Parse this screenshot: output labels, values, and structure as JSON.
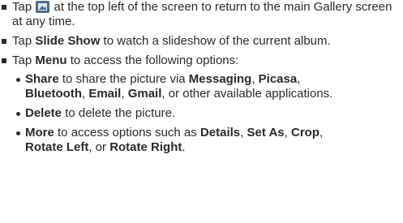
{
  "items": [
    {
      "before": "Tap ",
      "icon": "gallery-back-icon",
      "after": " at the top left of the screen to return to the main Gallery screen at any time."
    },
    {
      "pre": "Tap ",
      "bold": "Slide Show",
      "post": " to watch a slideshow of the current album."
    },
    {
      "pre": "Tap ",
      "bold": "Menu",
      "post": " to access the following options:"
    }
  ],
  "sub": {
    "share": {
      "bold": "Share",
      "t1": " to share the picture via ",
      "messaging": "Messaging",
      "c1": ", ",
      "picasa": "Picasa",
      "c2": ",",
      "bluetooth": "Bluetooth",
      "c3": ", ",
      "email": "Email",
      "c4": ", ",
      "gmail": "Gmail",
      "t2": ", or other available applications."
    },
    "delete": {
      "bold": "Delete",
      "text": " to delete the picture."
    },
    "more": {
      "bold": "More",
      "t1": " to access options such as ",
      "details": "Details",
      "c1": ", ",
      "setas": "Set As",
      "c2": ", ",
      "crop": "Crop",
      "c3": ",",
      "rotleft": "Rotate Left",
      "c4": ", or ",
      "rotright": "Rotate Right",
      "end": "."
    }
  },
  "colors": {
    "text": "#2b2b2b",
    "icon_bg": "#4e6d86"
  }
}
